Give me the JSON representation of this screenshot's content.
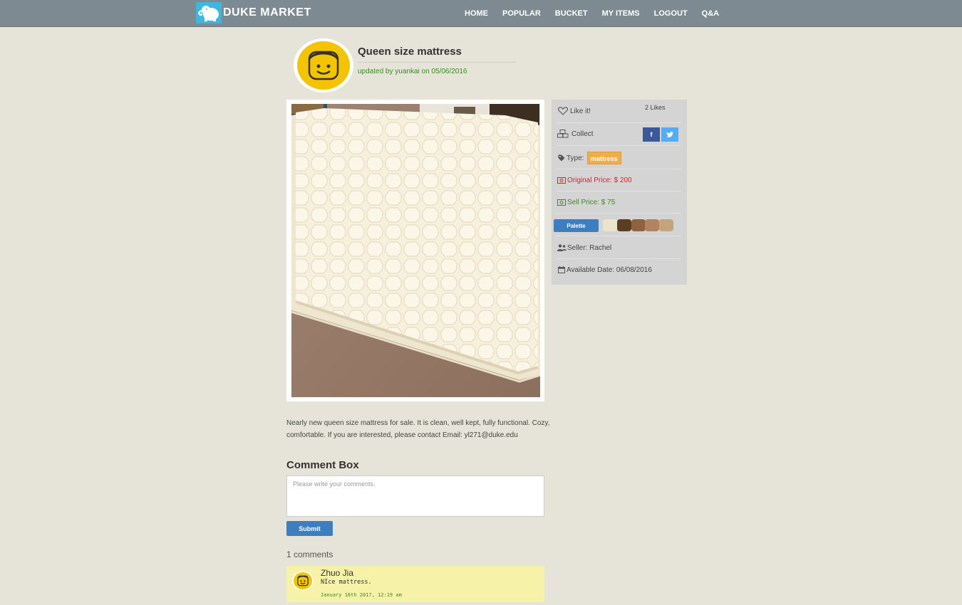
{
  "brand": {
    "name": "DUKE MARKET",
    "logo": "elephant-logo-icon"
  },
  "nav": [
    "HOME",
    "POPULAR",
    "BUCKET",
    "MY ITEMS",
    "LOGOUT",
    "Q&A"
  ],
  "item": {
    "title": "Queen size mattress",
    "updated": "updated by yuankai on 05/06/2016",
    "photo_alt": "mattress"
  },
  "panel": {
    "like_label": "Like it!",
    "likes_count": "2 Likes",
    "collect_label": "Collect",
    "facebook_label": "f",
    "twitter_label": "t",
    "type_label": "Type:",
    "type_value": "mattress",
    "original_price": "Original Price: $ 200",
    "sell_price": "Sell Price: $ 75",
    "palette_label": "Palette",
    "palette_colors": [
      "#ece3cf",
      "#5a3e22",
      "#8e6440",
      "#b2835e",
      "#c4a47c"
    ],
    "seller": "Seller: Rachel",
    "available_date": "Available Date: 06/08/2016"
  },
  "description": "Nearly new queen size mattress for sale. It is clean, well kept, fully functional. Cozy, comfortable. If you are interested, please contact Email: yl271@duke.edu",
  "comment_box": {
    "heading": "Comment Box",
    "placeholder": "Please write your comments.",
    "submit_label": "Submit"
  },
  "comments_count": "1 comments",
  "comments": [
    {
      "author": "Zhuo Jia",
      "text": "NIce mattress.",
      "time": "January 16th 2017, 12:19 am"
    }
  ],
  "colors": {
    "navbar": "#7d8a92",
    "background": "#e6e4d9",
    "accent": "#3c7ec0",
    "tag": "#f0ad4e",
    "original_price": "#e02020",
    "sell_price": "#3a8a23",
    "comment_bg": "#f6f2a8"
  }
}
